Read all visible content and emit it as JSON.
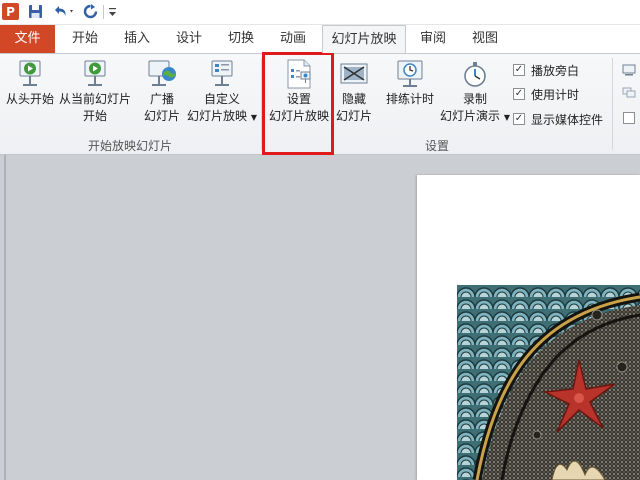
{
  "qat": {
    "app_logo": "P",
    "icons": [
      "save-icon",
      "undo-icon",
      "redo-icon",
      "customize-qat-icon"
    ]
  },
  "tabs": [
    {
      "label": "文件"
    },
    {
      "label": "开始"
    },
    {
      "label": "插入"
    },
    {
      "label": "设计"
    },
    {
      "label": "切换"
    },
    {
      "label": "动画"
    },
    {
      "label": "幻灯片放映"
    },
    {
      "label": "审阅"
    },
    {
      "label": "视图"
    }
  ],
  "active_tab_index": 6,
  "ribbon": {
    "start_group": {
      "label": "开始放映幻灯片",
      "from_beginning": {
        "line1": "从头开始"
      },
      "from_current": {
        "line1": "从当前幻灯片",
        "line2": "开始"
      },
      "broadcast": {
        "line1": "广播",
        "line2": "幻灯片"
      },
      "custom": {
        "line1": "自定义",
        "line2": "幻灯片放映"
      }
    },
    "setup_group": {
      "label": "设置",
      "setup_show": {
        "line1": "设置",
        "line2": "幻灯片放映"
      },
      "hide_slide": {
        "line1": "隐藏",
        "line2": "幻灯片"
      },
      "rehearse": {
        "line1": "排练计时"
      },
      "record": {
        "line1": "录制",
        "line2": "幻灯片演示"
      },
      "checkboxes": [
        {
          "label": "播放旁白",
          "checked": true
        },
        {
          "label": "使用计时",
          "checked": true
        },
        {
          "label": "显示媒体控件",
          "checked": true
        }
      ]
    }
  },
  "colors": {
    "file_tab": "#d24726",
    "highlight": "#e0191b",
    "workspace": "#cbced3"
  }
}
